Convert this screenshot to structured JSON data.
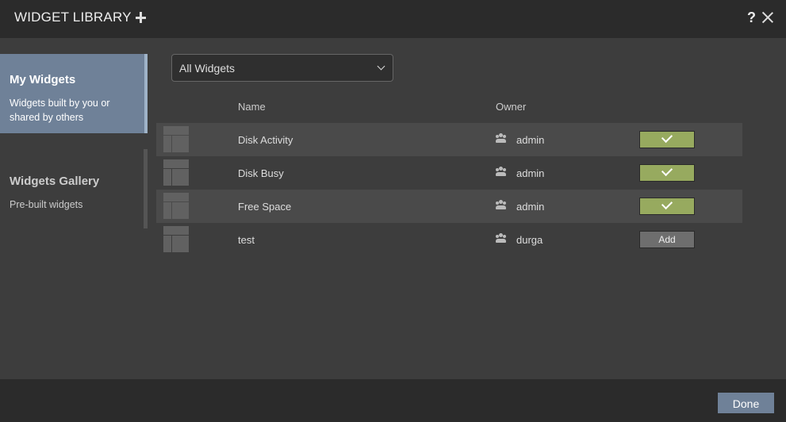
{
  "header": {
    "title": "WIDGET LIBRARY",
    "help_label": "?"
  },
  "sidebar": {
    "items": [
      {
        "title": "My Widgets",
        "description": "Widgets built by you or shared by others"
      },
      {
        "title": "Widgets Gallery",
        "description": "Pre-built widgets"
      }
    ]
  },
  "filter": {
    "selected": "All Widgets"
  },
  "table": {
    "columns": {
      "name": "Name",
      "owner": "Owner"
    },
    "rows": [
      {
        "name": "Disk Activity",
        "owner": "admin",
        "status": "added"
      },
      {
        "name": "Disk Busy",
        "owner": "admin",
        "status": "added"
      },
      {
        "name": "Free Space",
        "owner": "admin",
        "status": "added"
      },
      {
        "name": "test",
        "owner": "durga",
        "status": "add",
        "action_label": "Add"
      }
    ]
  },
  "footer": {
    "done_label": "Done"
  },
  "colors": {
    "accent": "#6f8198",
    "added": "#97aa5f",
    "header_bg": "#2b2b2b",
    "body_bg": "#3d3d3d"
  },
  "icons": [
    "plus-icon",
    "help-icon",
    "close-icon",
    "chevron-down-icon",
    "widget-thumbnail-icon",
    "group-icon",
    "check-icon"
  ]
}
